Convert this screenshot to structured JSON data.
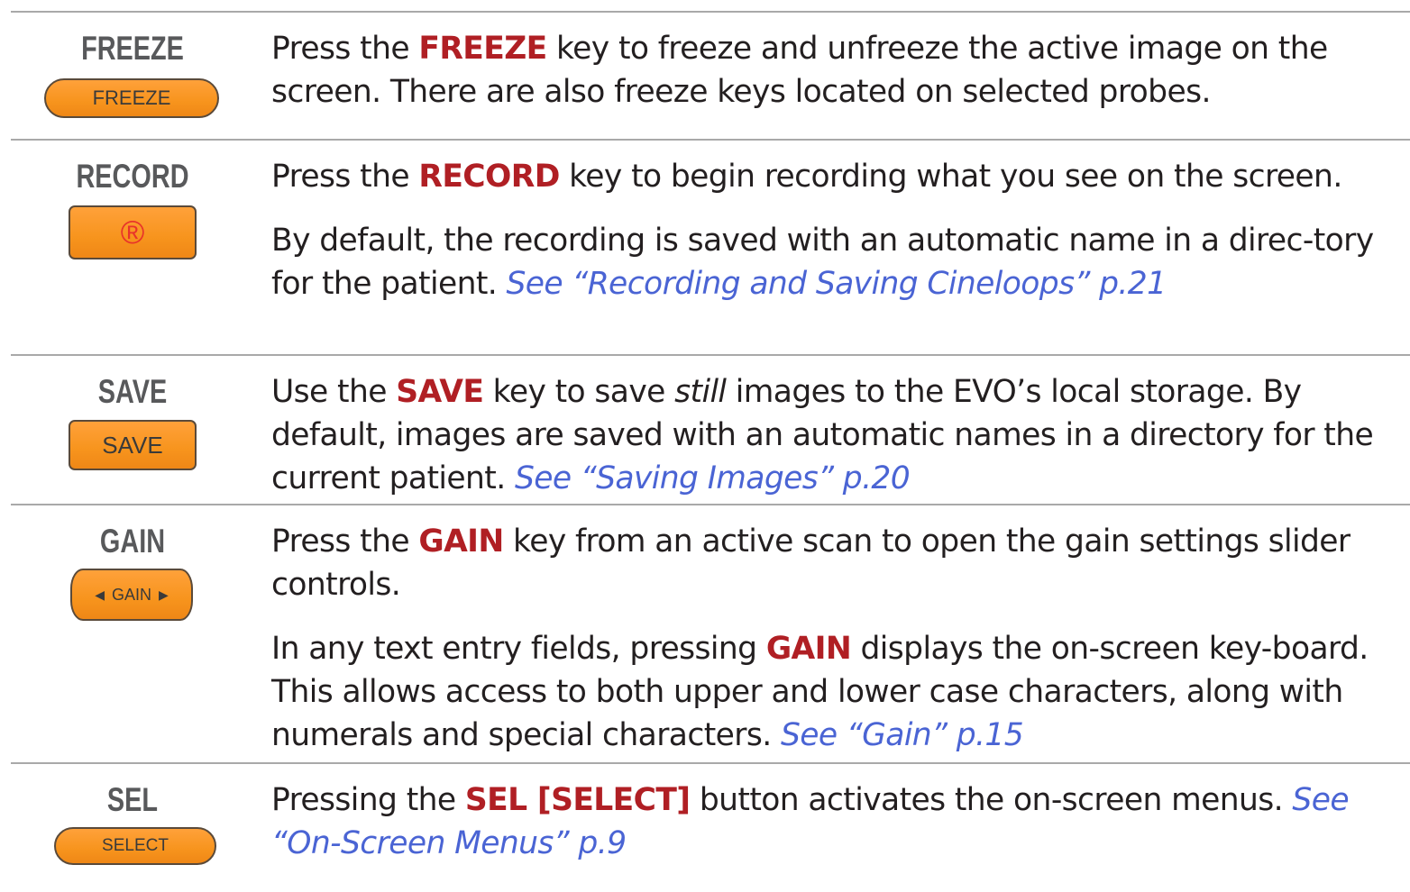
{
  "rows": [
    {
      "key_label": "FREEZE",
      "button_label": "FREEZE",
      "paragraphs": [
        {
          "parts": [
            {
              "t": "Press the "
            },
            {
              "t": "FREEZE",
              "k": "kw"
            },
            {
              "t": " key to freeze and unfreeze the active image on the screen. There are also freeze keys located on selected probes."
            }
          ]
        }
      ]
    },
    {
      "key_label": "RECORD",
      "button_label": "®",
      "paragraphs": [
        {
          "parts": [
            {
              "t": "Press the "
            },
            {
              "t": "RECORD",
              "k": "kw"
            },
            {
              "t": " key to begin recording what you see on the screen."
            }
          ]
        },
        {
          "parts": [
            {
              "t": "By default, the recording is saved with an automatic name in a direc-tory for the patient. "
            },
            {
              "t": "See “Recording and Saving Cineloops” p.21",
              "k": "link"
            }
          ]
        }
      ]
    },
    {
      "key_label": "SAVE",
      "button_label": "SAVE",
      "paragraphs": [
        {
          "parts": [
            {
              "t": "Use the "
            },
            {
              "t": "SAVE",
              "k": "kw"
            },
            {
              "t": " key to save "
            },
            {
              "t": "still",
              "k": "em"
            },
            {
              "t": " images to the EVO’s local storage. By default, images are saved with an automatic names in a directory for the current patient. "
            },
            {
              "t": "See “Saving Images” p.20",
              "k": "link"
            }
          ]
        }
      ]
    },
    {
      "key_label": "GAIN",
      "button_label": "GAIN",
      "paragraphs": [
        {
          "parts": [
            {
              "t": "Press the "
            },
            {
              "t": "GAIN",
              "k": "kw"
            },
            {
              "t": " key from an active scan to open the gain settings slider controls."
            }
          ]
        },
        {
          "parts": [
            {
              "t": "In any text entry fields, pressing "
            },
            {
              "t": "GAIN",
              "k": "kw"
            },
            {
              "t": " displays the on-screen key-board. This allows access to both upper and lower case characters, along with numerals and special characters. "
            },
            {
              "t": "See “Gain” p.15",
              "k": "link"
            }
          ]
        }
      ]
    },
    {
      "key_label": "SEL",
      "button_label": "SELECT",
      "paragraphs": [
        {
          "parts": [
            {
              "t": "Pressing the "
            },
            {
              "t": "SEL [SELECT]",
              "k": "kw"
            },
            {
              "t": " button activates the on-screen menus. "
            },
            {
              "t": "See “On-Screen Menus” p.9",
              "k": "link"
            }
          ]
        }
      ]
    }
  ]
}
